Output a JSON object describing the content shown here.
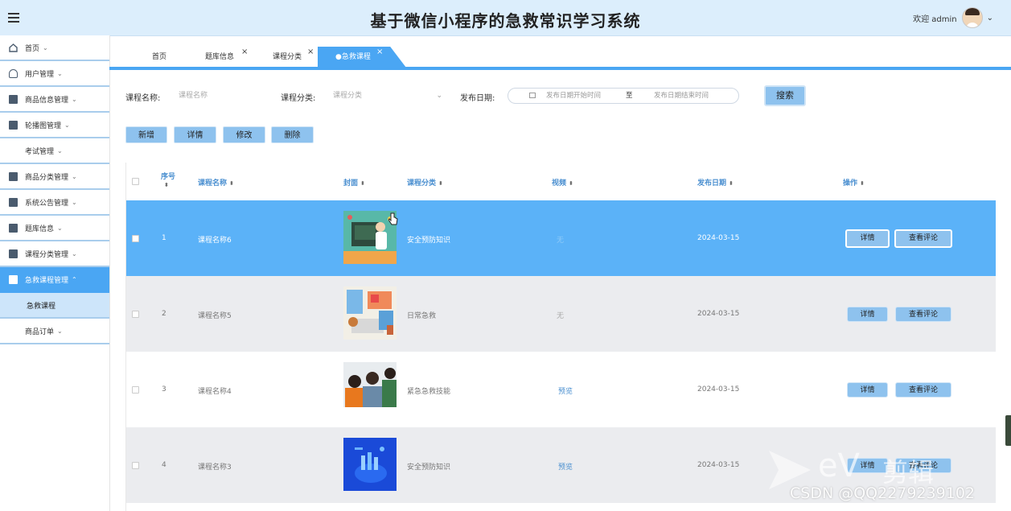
{
  "header": {
    "title": "基于微信小程序的急救常识学习系统",
    "welcome": "欢迎 admin"
  },
  "sidebar": {
    "items": [
      {
        "label": "首页"
      },
      {
        "label": "用户管理"
      },
      {
        "label": "商品信息管理"
      },
      {
        "label": "轮播图管理"
      },
      {
        "label": "考试管理"
      },
      {
        "label": "商品分类管理"
      },
      {
        "label": "系统公告管理"
      },
      {
        "label": "题库信息"
      },
      {
        "label": "课程分类管理"
      },
      {
        "label": "急救课程管理"
      },
      {
        "label": "急救课程"
      },
      {
        "label": "商品订单"
      }
    ]
  },
  "tabs": [
    {
      "label": "首页"
    },
    {
      "label": "题库信息"
    },
    {
      "label": "课程分类"
    },
    {
      "label": "●急救课程"
    }
  ],
  "search": {
    "name_label": "课程名称:",
    "name_placeholder": "课程名称",
    "category_label": "课程分类:",
    "category_placeholder": "课程分类",
    "date_label": "发布日期:",
    "date_start": "发布日期开始时间",
    "date_to": "至",
    "date_end": "发布日期结束时间",
    "search_button": "搜索"
  },
  "actions": {
    "add": "新增",
    "detail": "详情",
    "edit": "修改",
    "delete": "删除"
  },
  "table": {
    "headers": {
      "index": "序号",
      "name": "课程名称",
      "cover": "封面",
      "category": "课程分类",
      "video": "视频",
      "date": "发布日期",
      "ops": "操作"
    },
    "rows": [
      {
        "index": "1",
        "name": "课程名称6",
        "category": "安全预防知识",
        "video": "无",
        "date": "2024-03-15",
        "detail": "详情",
        "comments": "查看评论"
      },
      {
        "index": "2",
        "name": "课程名称5",
        "category": "日常急救",
        "video": "无",
        "date": "2024-03-15",
        "detail": "详情",
        "comments": "查看评论"
      },
      {
        "index": "3",
        "name": "课程名称4",
        "category": "紧急急救技能",
        "video": "预览",
        "date": "2024-03-15",
        "detail": "详情",
        "comments": "查看评论"
      },
      {
        "index": "4",
        "name": "课程名称3",
        "category": "安全预防知识",
        "video": "预览",
        "date": "2024-03-15",
        "detail": "详情",
        "comments": "查看评论"
      }
    ]
  },
  "watermark": {
    "ev": "eV",
    "editor": "剪辑",
    "csdn": "CSDN @QQ2279239102"
  },
  "colors": {
    "accent": "#4aa6f3",
    "header_bg": "#dceefc",
    "selected_row": "#5bb2f8",
    "button": "#8ec2ee"
  }
}
